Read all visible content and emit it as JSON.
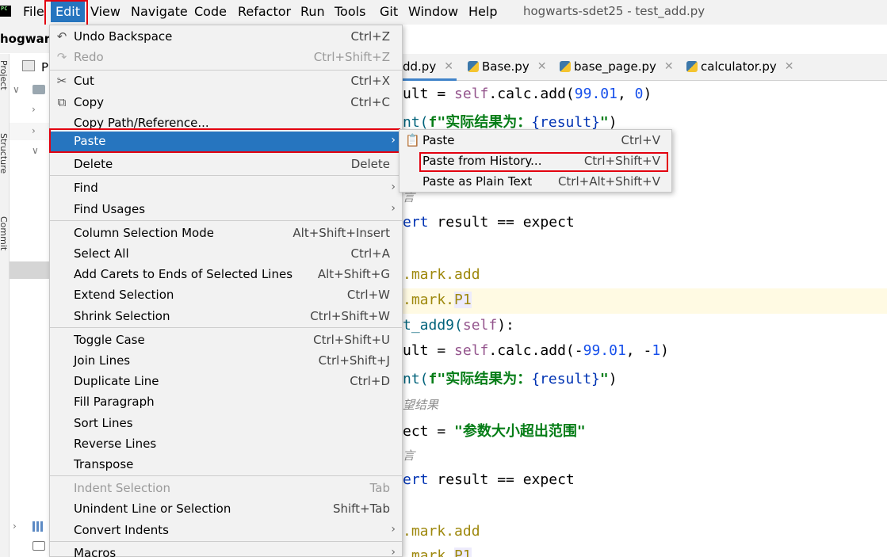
{
  "menubar": {
    "logo": "PC",
    "items": [
      "File",
      "Edit",
      "View",
      "Navigate",
      "Code",
      "Refactor",
      "Run",
      "Tools",
      "Git",
      "Window",
      "Help"
    ],
    "window_title": "hogwarts-sdet25 - test_add.py"
  },
  "project": {
    "name": "hogwart",
    "pane_label": "P",
    "side_tabs": [
      "Project",
      "Structure",
      "Commit"
    ]
  },
  "tabs": [
    {
      "label": "dd.py"
    },
    {
      "label": "Base.py"
    },
    {
      "label": "base_page.py"
    },
    {
      "label": "calculator.py"
    }
  ],
  "edit_menu": {
    "items": [
      {
        "label": "Undo Backspace",
        "shortcut": "Ctrl+Z",
        "icon": "undo-icon"
      },
      {
        "label": "Redo",
        "shortcut": "Ctrl+Shift+Z",
        "icon": "redo-icon",
        "disabled": true
      },
      {
        "label": "Cut",
        "shortcut": "Ctrl+X",
        "icon": "scissors-icon"
      },
      {
        "label": "Copy",
        "shortcut": "Ctrl+C",
        "icon": "copy-icon"
      },
      {
        "label": "Copy Path/Reference...",
        "shortcut": ""
      },
      {
        "label": "Paste",
        "shortcut": "",
        "submenu": true,
        "selected": true
      },
      {
        "label": "Delete",
        "shortcut": "Delete"
      },
      {
        "label": "Find",
        "shortcut": "",
        "submenu": true
      },
      {
        "label": "Find Usages",
        "shortcut": "",
        "submenu": true
      },
      {
        "label": "Column Selection Mode",
        "shortcut": "Alt+Shift+Insert"
      },
      {
        "label": "Select All",
        "shortcut": "Ctrl+A"
      },
      {
        "label": "Add Carets to Ends of Selected Lines",
        "shortcut": "Alt+Shift+G"
      },
      {
        "label": "Extend Selection",
        "shortcut": "Ctrl+W"
      },
      {
        "label": "Shrink Selection",
        "shortcut": "Ctrl+Shift+W"
      },
      {
        "label": "Toggle Case",
        "shortcut": "Ctrl+Shift+U"
      },
      {
        "label": "Join Lines",
        "shortcut": "Ctrl+Shift+J"
      },
      {
        "label": "Duplicate Line",
        "shortcut": "Ctrl+D"
      },
      {
        "label": "Fill Paragraph",
        "shortcut": ""
      },
      {
        "label": "Sort Lines",
        "shortcut": ""
      },
      {
        "label": "Reverse Lines",
        "shortcut": ""
      },
      {
        "label": "Transpose",
        "shortcut": ""
      },
      {
        "label": "Indent Selection",
        "shortcut": "Tab",
        "disabled": true
      },
      {
        "label": "Unindent Line or Selection",
        "shortcut": "Shift+Tab"
      },
      {
        "label": "Convert Indents",
        "shortcut": "",
        "submenu": true
      },
      {
        "label": "Macros",
        "shortcut": "",
        "submenu": true
      }
    ]
  },
  "paste_submenu": {
    "items": [
      {
        "label": "Paste",
        "shortcut": "Ctrl+V",
        "icon": "clipboard-icon"
      },
      {
        "label": "Paste from History...",
        "shortcut": "Ctrl+Shift+V"
      },
      {
        "label": "Paste as Plain Text",
        "shortcut": "Ctrl+Alt+Shift+V"
      }
    ]
  },
  "code": {
    "l1a": "ult = ",
    "l1b": "self",
    "l1c": ".calc.add(",
    "l1d": "99.01",
    "l1e": ", ",
    "l1f": "0",
    "l1g": ")",
    "l2a": "nt(",
    "l2b": "f\"实际结果为：",
    "l2c": "{result}",
    "l2d": "\"",
    "l2e": ")",
    "l3": "言",
    "l4a": "ert",
    "l4b": " result == expect",
    "l5": ".mark.add",
    "l6a": ".mark.",
    "l6b": "P1",
    "l7a": "t_add9(",
    "l7b": "self",
    "l7c": "):",
    "l8a": "ult = ",
    "l8b": "self",
    "l8c": ".calc.add(-",
    "l8d": "99.01",
    "l8e": ", -",
    "l8f": "1",
    "l8g": ")",
    "l9a": "nt(",
    "l9b": "f\"实际结果为：",
    "l9c": "{result}",
    "l9d": "\"",
    "l9e": ")",
    "l10": "望结果",
    "l11a": "ect = ",
    "l11b": "\"参数大小超出范围\"",
    "l12": "言",
    "l13a": "ert",
    "l13b": " result == expect",
    "l14": ".mark.add",
    "l15a": ".mark.",
    "l15b": "P1"
  }
}
